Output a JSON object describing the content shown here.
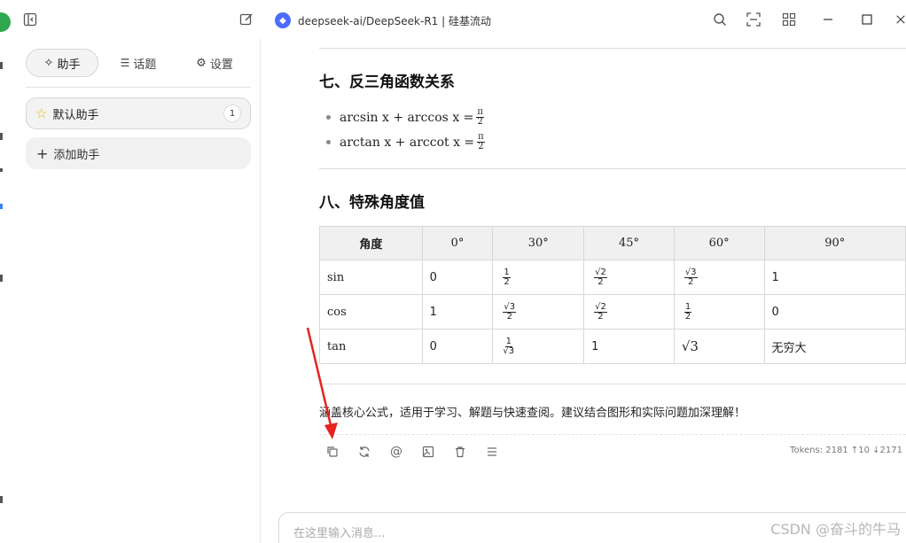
{
  "titlebar": {
    "model_title": "deepseek-ai/DeepSeek-R1 | 硅基流动",
    "icons": [
      "sidebar-toggle-icon",
      "edit-icon",
      "search-icon",
      "scan-icon",
      "grid-icon",
      "minimize-icon",
      "maximize-icon",
      "close-icon"
    ]
  },
  "sidebar": {
    "tabs": [
      {
        "label": "助手",
        "icon": "sparkle-icon"
      },
      {
        "label": "话题",
        "icon": "list-icon"
      },
      {
        "label": "设置",
        "icon": "gear-icon"
      }
    ],
    "assistant": {
      "label": "默认助手",
      "count": "1"
    },
    "add_label": "添加助手"
  },
  "chat": {
    "section7": {
      "title": "七、反三角函数关系",
      "items": [
        {
          "lhs": "arcsin x + arccos x =",
          "num": "π",
          "den": "2"
        },
        {
          "lhs": "arctan x + arccot x =",
          "num": "π",
          "den": "2"
        }
      ]
    },
    "section8": {
      "title": "八、特殊角度值",
      "headers": [
        "角度",
        "0°",
        "30°",
        "45°",
        "60°",
        "90°"
      ],
      "rows": [
        {
          "fn": "sin",
          "v0": "0",
          "v30": {
            "num": "1",
            "den": "2"
          },
          "v45": {
            "num": "√2",
            "den": "2"
          },
          "v60": {
            "num": "√3",
            "den": "2"
          },
          "v90": "1"
        },
        {
          "fn": "cos",
          "v0": "1",
          "v30": {
            "num": "√3",
            "den": "2"
          },
          "v45": {
            "num": "√2",
            "den": "2"
          },
          "v60": {
            "num": "1",
            "den": "2"
          },
          "v90": "0"
        },
        {
          "fn": "tan",
          "v0": "0",
          "v30": {
            "num": "1",
            "den": "√3"
          },
          "v45": "1",
          "v60": "√3",
          "v90": "无穷大"
        }
      ]
    },
    "summary": "涵盖核心公式，适用于学习、解题与快速查阅。建议结合图形和实际问题加深理解！",
    "action_icons": [
      "copy-icon",
      "regenerate-icon",
      "mention-icon",
      "image-icon",
      "delete-icon",
      "menu-icon"
    ],
    "tokens": "Tokens: 2181 ↑10 ↓2171",
    "input_placeholder": "在这里输入消息...",
    "watermark": "CSDN @奋斗的牛马",
    "arrow_color": "#e8221f"
  }
}
